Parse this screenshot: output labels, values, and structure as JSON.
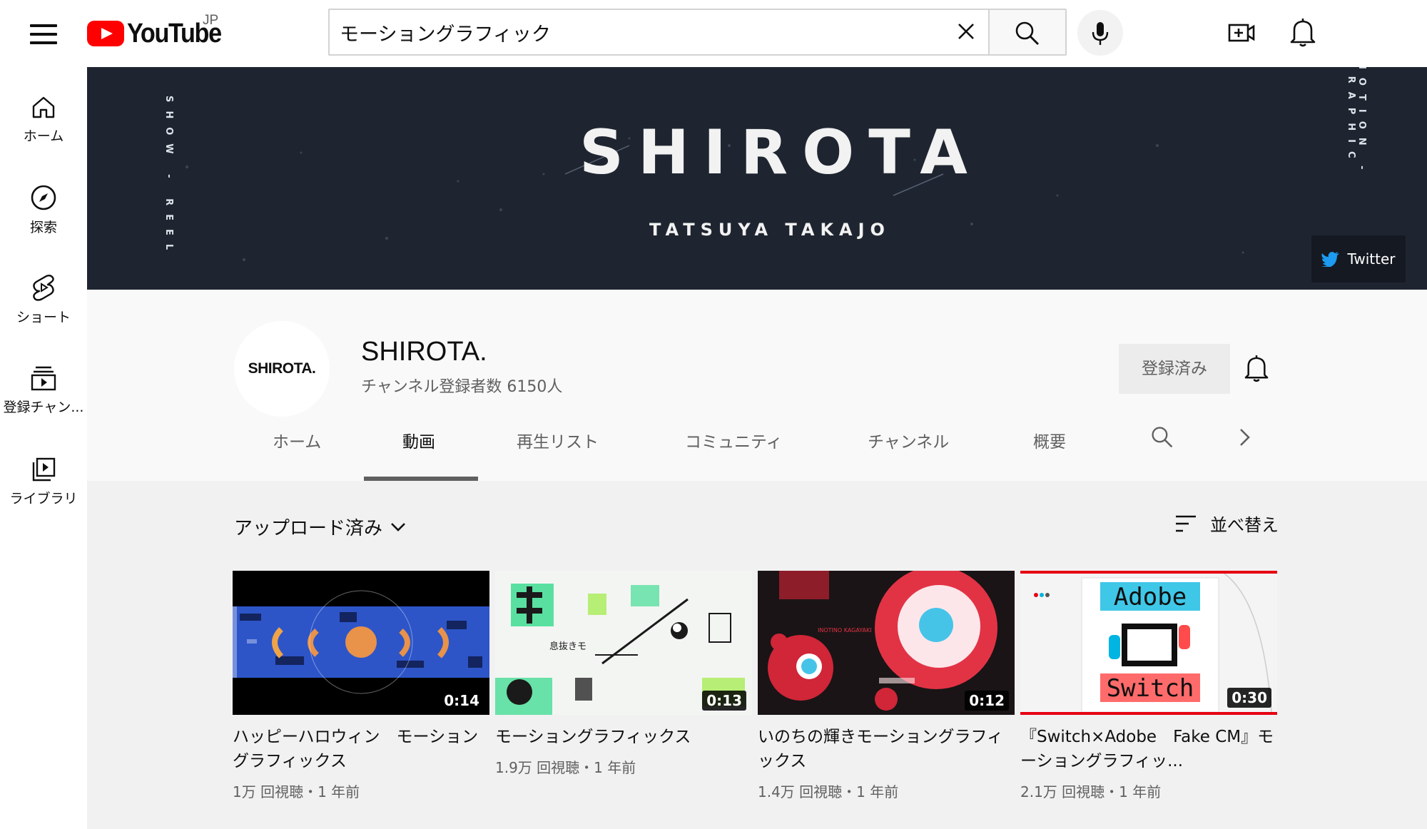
{
  "header": {
    "logo_text": "YouTube",
    "region": "JP",
    "search_value": "モーショングラフィック"
  },
  "rail": {
    "items": [
      {
        "label": "ホーム"
      },
      {
        "label": "探索"
      },
      {
        "label": "ショート"
      },
      {
        "label": "登録チャン..."
      },
      {
        "label": "ライブラリ"
      }
    ]
  },
  "banner": {
    "title": "SHIROTA",
    "subtitle": "TATSUYA TAKAJO",
    "side_left": "SHOW - REEL",
    "side_right": "MOTION - GRAPHIC",
    "twitter_label": "Twitter"
  },
  "channel": {
    "avatar_text": "SHIROTA.",
    "name": "SHIROTA.",
    "subscribers": "チャンネル登録者数 6150人",
    "subscribed_label": "登録済み",
    "tabs": [
      {
        "label": "ホーム"
      },
      {
        "label": "動画"
      },
      {
        "label": "再生リスト"
      },
      {
        "label": "コミュニティ"
      },
      {
        "label": "チャンネル"
      },
      {
        "label": "概要"
      }
    ]
  },
  "content": {
    "filter_label": "アップロード済み",
    "sort_label": "並べ替え",
    "videos": [
      {
        "title": "ハッピーハロウィン　モーショングラフィックス",
        "meta": "1万 回視聴・1 年前",
        "duration": "0:14"
      },
      {
        "title": "モーショングラフィックス",
        "meta": "1.9万 回視聴・1 年前",
        "duration": "0:13"
      },
      {
        "title": "いのちの輝きモーショングラフィックス",
        "meta": "1.4万 回視聴・1 年前",
        "duration": "0:12"
      },
      {
        "title": "『Switch×Adobe　Fake CM』モーショングラフィッ...",
        "meta": "2.1万 回視聴・1 年前",
        "duration": "0:30"
      }
    ],
    "thumb_texts": {
      "v2_text": "息抜きモ",
      "v3_text": "INOTINO KAGAYAKI",
      "v4_top": "Adobe",
      "v4_bottom": "Switch"
    }
  },
  "colors": {
    "brand_red": "#ff0000",
    "banner_bg": "#1f2530",
    "accent_teal": "#5fb7b7"
  }
}
